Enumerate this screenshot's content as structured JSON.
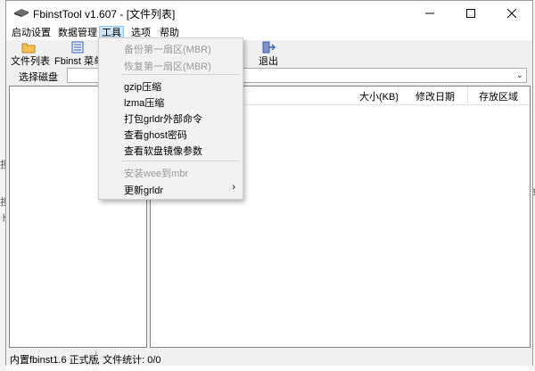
{
  "window": {
    "title": "FbinstTool v1.607 - [文件列表]"
  },
  "menubar": [
    "启动设置",
    "数据管理",
    "工具",
    "选项",
    "帮助"
  ],
  "toolbar": {
    "file_list": "文件列表",
    "fbinst_menu": "Fbinst 菜单",
    "exit": "退出"
  },
  "disk": {
    "label": "选择磁盘",
    "value": ""
  },
  "list": {
    "columns": [
      "大小(KB)",
      "修改日期",
      "存放区域"
    ]
  },
  "tools_menu": {
    "items": [
      {
        "label": "备份第一扇区(MBR)",
        "disabled": true
      },
      {
        "label": "恢复第一扇区(MBR)",
        "disabled": true
      },
      {
        "label": "gzip压缩",
        "disabled": false
      },
      {
        "label": "lzma压缩",
        "disabled": false
      },
      {
        "label": "打包grldr外部命令",
        "disabled": false
      },
      {
        "label": "查看ghost密码",
        "disabled": false
      },
      {
        "label": "查看软盘镜像参数",
        "disabled": false
      },
      {
        "label": "安装wee到mbr",
        "disabled": true
      },
      {
        "label": "更新grldr",
        "disabled": false,
        "submenu": true
      }
    ]
  },
  "status": {
    "version": "内置fbinst1.6 正式版",
    "file_stats": ", 文件统计: 0/0"
  },
  "background": [
    "担",
    "担",
    "ト",
    "/",
    "B",
    "/"
  ],
  "colors": {
    "menu_active_bg": "#cce4f7",
    "menu_active_border": "#99c9ef",
    "disabled_text": "#9a9a9a"
  }
}
